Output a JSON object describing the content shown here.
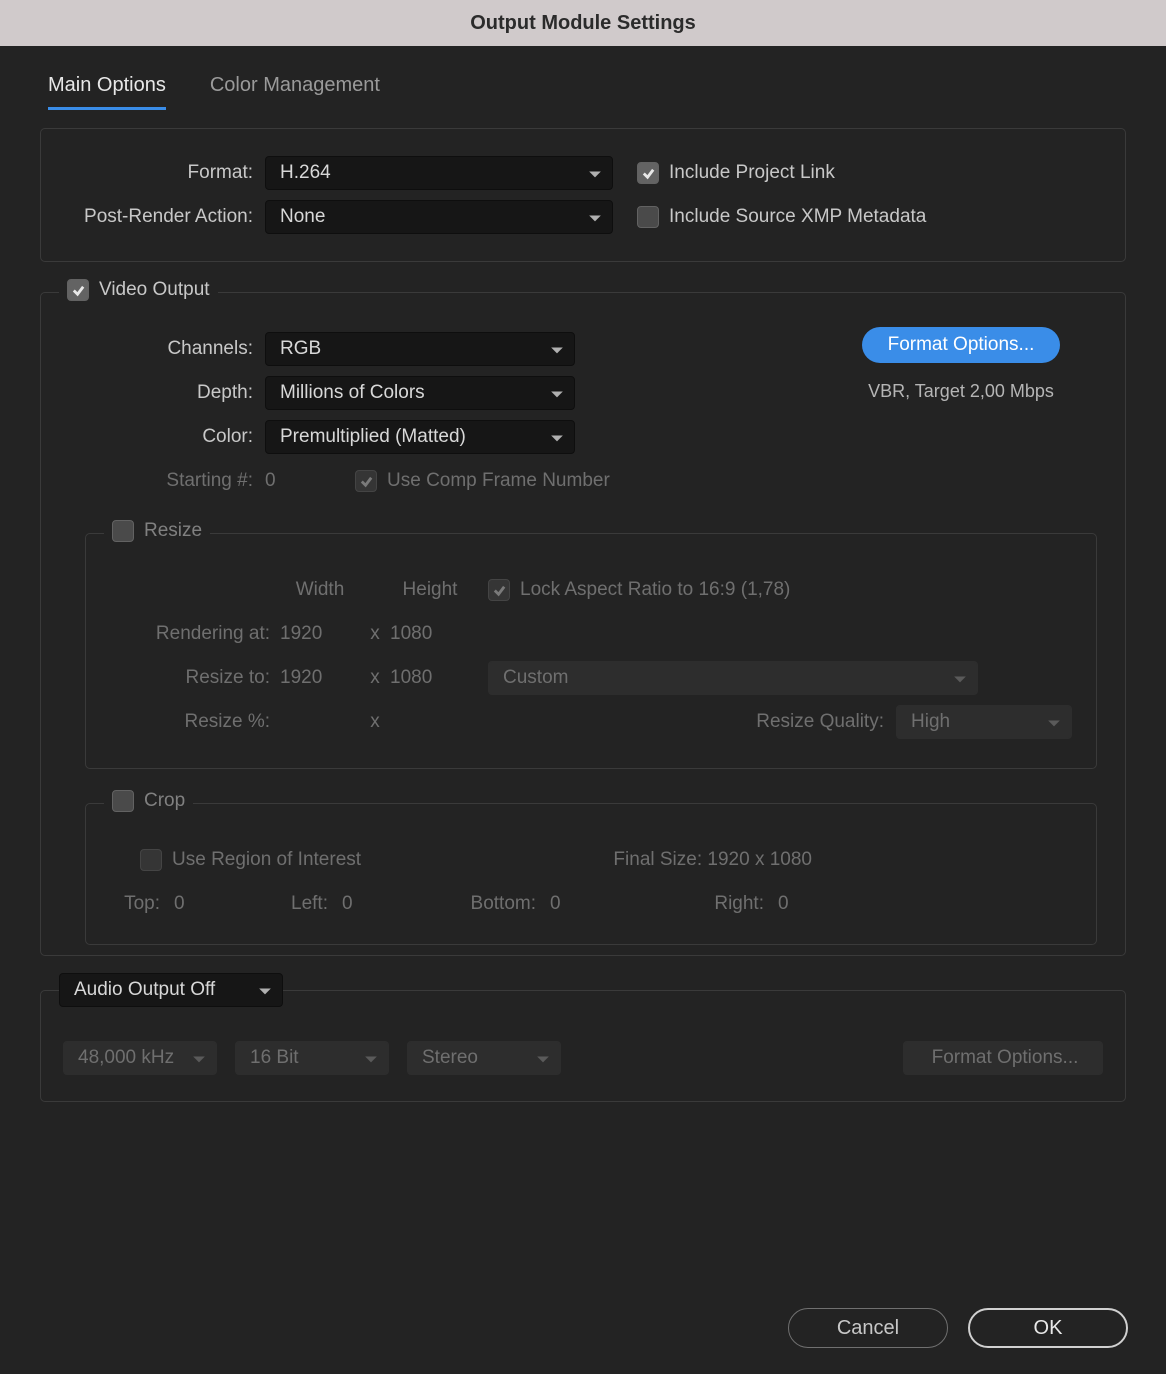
{
  "title": "Output Module Settings",
  "tabs": {
    "main": "Main Options",
    "color": "Color Management"
  },
  "format_section": {
    "format_label": "Format:",
    "format_value": "H.264",
    "post_render_label": "Post-Render Action:",
    "post_render_value": "None",
    "include_project_link": "Include Project Link",
    "include_xmp": "Include Source XMP Metadata"
  },
  "video": {
    "legend": "Video Output",
    "channels_label": "Channels:",
    "channels_value": "RGB",
    "depth_label": "Depth:",
    "depth_value": "Millions of Colors",
    "color_label": "Color:",
    "color_value": "Premultiplied (Matted)",
    "starting_label": "Starting #:",
    "starting_value": "0",
    "use_comp_frame": "Use Comp Frame Number",
    "format_options_btn": "Format Options...",
    "codec_info": "VBR, Target 2,00 Mbps"
  },
  "resize": {
    "legend": "Resize",
    "width_hdr": "Width",
    "height_hdr": "Height",
    "lock_aspect": "Lock Aspect Ratio to 16:9 (1,78)",
    "rendering_at_label": "Rendering at:",
    "render_w": "1920",
    "render_h": "1080",
    "resize_to_label": "Resize to:",
    "resize_w": "1920",
    "resize_h": "1080",
    "custom": "Custom",
    "resize_pct_label": "Resize %:",
    "quality_label": "Resize Quality:",
    "quality_value": "High"
  },
  "crop": {
    "legend": "Crop",
    "use_roi": "Use Region of Interest",
    "final_size_label": "Final Size: 1920 x 1080",
    "top_label": "Top:",
    "top_val": "0",
    "left_label": "Left:",
    "left_val": "0",
    "bottom_label": "Bottom:",
    "bottom_val": "0",
    "right_label": "Right:",
    "right_val": "0"
  },
  "audio": {
    "mode": "Audio Output Off",
    "rate": "48,000 kHz",
    "depth": "16 Bit",
    "channels": "Stereo",
    "format_options": "Format Options..."
  },
  "buttons": {
    "cancel": "Cancel",
    "ok": "OK"
  },
  "x": "x"
}
